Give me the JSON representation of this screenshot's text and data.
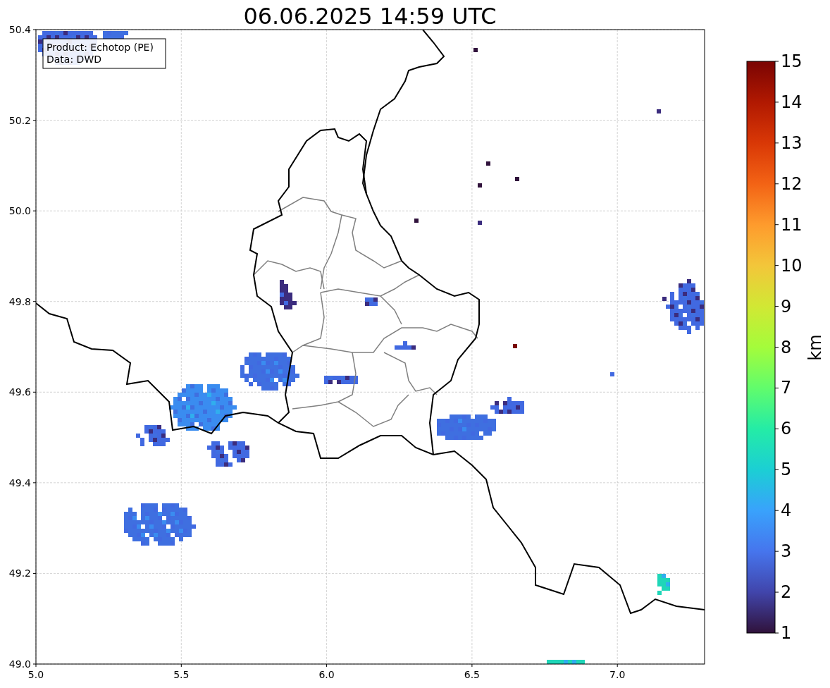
{
  "title": "06.06.2025 14:59 UTC",
  "annotation": [
    "Product: Echotop (PE)",
    "Data: DWD"
  ],
  "xticks": [
    "5.0",
    "5.5",
    "6.0",
    "6.5",
    "7.0"
  ],
  "yticks": [
    "50.4",
    "50.2",
    "50.0",
    "49.8",
    "49.6",
    "49.4",
    "49.2",
    "49.0"
  ],
  "colorbar": {
    "label": "km",
    "ticks": [
      "15",
      "14",
      "13",
      "12",
      "11",
      "10",
      "9",
      "8",
      "7",
      "6",
      "5",
      "4",
      "3",
      "2",
      "1"
    ]
  }
}
